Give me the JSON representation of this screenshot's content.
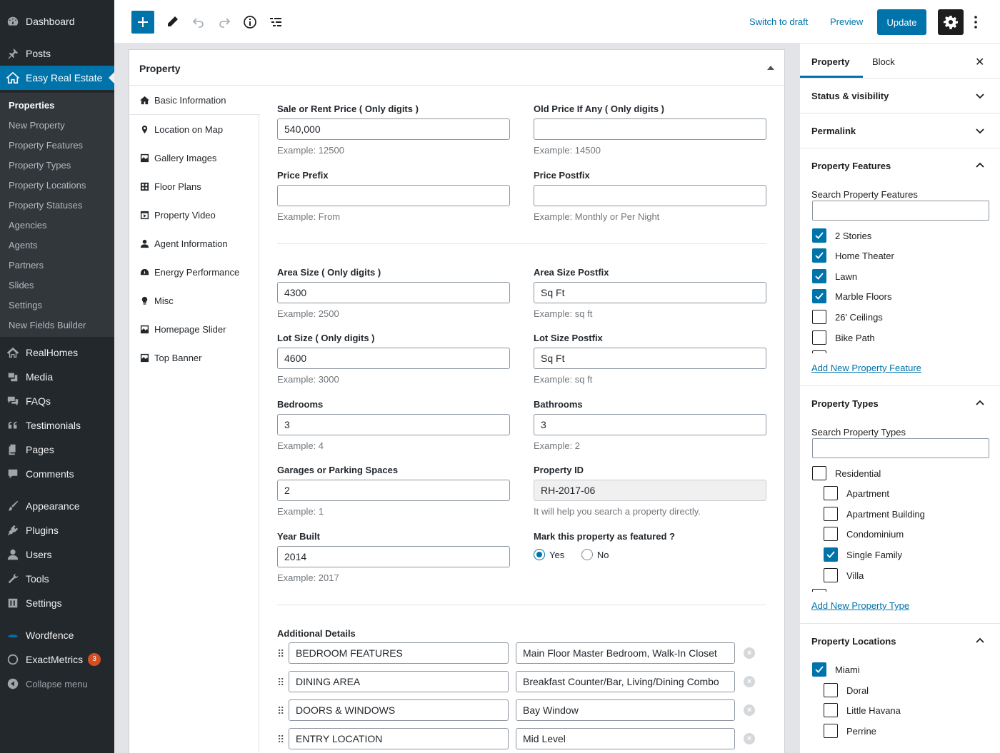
{
  "admin_menu": {
    "top_items": [
      {
        "label": "Dashboard",
        "icon": "dashboard-icon"
      },
      {
        "label": "Posts",
        "icon": "pin-icon"
      },
      {
        "label": "Easy Real Estate",
        "icon": "house-icon"
      },
      {
        "label": "RealHomes",
        "icon": "house-outline-icon"
      },
      {
        "label": "Media",
        "icon": "media-icon"
      },
      {
        "label": "FAQs",
        "icon": "chat-icon"
      },
      {
        "label": "Testimonials",
        "icon": "quote-icon"
      },
      {
        "label": "Pages",
        "icon": "pages-icon"
      },
      {
        "label": "Comments",
        "icon": "comment-icon"
      },
      {
        "label": "Appearance",
        "icon": "brush-icon"
      },
      {
        "label": "Plugins",
        "icon": "plug-icon"
      },
      {
        "label": "Users",
        "icon": "user-icon"
      },
      {
        "label": "Tools",
        "icon": "wrench-icon"
      },
      {
        "label": "Settings",
        "icon": "sliders-icon"
      },
      {
        "label": "Wordfence",
        "icon": "wordfence-icon"
      },
      {
        "label": "ExactMetrics",
        "icon": "metrics-icon",
        "badge": "3"
      }
    ],
    "submenu": [
      "Properties",
      "New Property",
      "Property Features",
      "Property Types",
      "Property Locations",
      "Property Statuses",
      "Agencies",
      "Agents",
      "Partners",
      "Slides",
      "Settings",
      "New Fields Builder"
    ],
    "collapse_label": "Collapse menu"
  },
  "toolbar": {
    "switch_draft": "Switch to draft",
    "preview": "Preview",
    "update": "Update"
  },
  "metabox": {
    "title": "Property",
    "tabs": [
      {
        "label": "Basic Information",
        "icon": "home-icon"
      },
      {
        "label": "Location on Map",
        "icon": "map-pin-icon"
      },
      {
        "label": "Gallery Images",
        "icon": "gallery-icon"
      },
      {
        "label": "Floor Plans",
        "icon": "floor-plan-icon"
      },
      {
        "label": "Property Video",
        "icon": "video-icon"
      },
      {
        "label": "Agent Information",
        "icon": "agent-icon"
      },
      {
        "label": "Energy Performance",
        "icon": "gauge-icon"
      },
      {
        "label": "Misc",
        "icon": "bulb-icon"
      },
      {
        "label": "Homepage Slider",
        "icon": "slider-icon"
      },
      {
        "label": "Top Banner",
        "icon": "banner-icon"
      }
    ],
    "fields": {
      "price": {
        "label": "Sale or Rent Price ( Only digits )",
        "value": "540,000",
        "example": "Example: 12500"
      },
      "old_price": {
        "label": "Old Price If Any ( Only digits )",
        "value": "",
        "example": "Example: 14500"
      },
      "price_prefix": {
        "label": "Price Prefix",
        "value": "",
        "example": "Example: From"
      },
      "price_postfix": {
        "label": "Price Postfix",
        "value": "",
        "example": "Example: Monthly or Per Night"
      },
      "area_size": {
        "label": "Area Size ( Only digits )",
        "value": "4300",
        "example": "Example: 2500"
      },
      "area_postfix": {
        "label": "Area Size Postfix",
        "value": "Sq Ft",
        "example": "Example: sq ft"
      },
      "lot_size": {
        "label": "Lot Size ( Only digits )",
        "value": "4600",
        "example": "Example: 3000"
      },
      "lot_postfix": {
        "label": "Lot Size Postfix",
        "value": "Sq Ft",
        "example": "Example: sq ft"
      },
      "bedrooms": {
        "label": "Bedrooms",
        "value": "3",
        "example": "Example: 4"
      },
      "bathrooms": {
        "label": "Bathrooms",
        "value": "3",
        "example": "Example: 2"
      },
      "garages": {
        "label": "Garages or Parking Spaces",
        "value": "2",
        "example": "Example: 1"
      },
      "property_id": {
        "label": "Property ID",
        "value": "RH-2017-06",
        "example": "It will help you search a property directly."
      },
      "year_built": {
        "label": "Year Built",
        "value": "2014",
        "example": "Example: 2017"
      },
      "featured": {
        "label": "Mark this property as featured ?",
        "yes": "Yes",
        "no": "No",
        "selected": "Yes"
      }
    },
    "additional": {
      "label": "Additional Details",
      "rows": [
        {
          "key": "BEDROOM FEATURES",
          "value": "Main Floor Master Bedroom, Walk-In Closet"
        },
        {
          "key": "DINING AREA",
          "value": "Breakfast Counter/Bar, Living/Dining Combo"
        },
        {
          "key": "DOORS & WINDOWS",
          "value": "Bay Window"
        },
        {
          "key": "ENTRY LOCATION",
          "value": "Mid Level"
        }
      ]
    }
  },
  "sidebar": {
    "tabs": [
      "Property",
      "Block"
    ],
    "panels": {
      "status": "Status & visibility",
      "permalink": "Permalink",
      "features": {
        "title": "Property Features",
        "search_label": "Search Property Features",
        "items": [
          {
            "label": "2 Stories",
            "checked": true
          },
          {
            "label": "Home Theater",
            "checked": true
          },
          {
            "label": "Lawn",
            "checked": true
          },
          {
            "label": "Marble Floors",
            "checked": true
          },
          {
            "label": "26' Ceilings",
            "checked": false
          },
          {
            "label": "Bike Path",
            "checked": false
          }
        ],
        "add_link": "Add New Property Feature"
      },
      "types": {
        "title": "Property Types",
        "search_label": "Search Property Types",
        "items": [
          {
            "label": "Residential",
            "checked": false,
            "child": false
          },
          {
            "label": "Apartment",
            "checked": false,
            "child": true
          },
          {
            "label": "Apartment Building",
            "checked": false,
            "child": true
          },
          {
            "label": "Condominium",
            "checked": false,
            "child": true
          },
          {
            "label": "Single Family",
            "checked": true,
            "child": true
          },
          {
            "label": "Villa",
            "checked": false,
            "child": true
          }
        ],
        "add_link": "Add New Property Type"
      },
      "locations": {
        "title": "Property Locations",
        "items": [
          {
            "label": "Miami",
            "checked": true,
            "child": false
          },
          {
            "label": "Doral",
            "checked": false,
            "child": true
          },
          {
            "label": "Little Havana",
            "checked": false,
            "child": true
          },
          {
            "label": "Perrine",
            "checked": false,
            "child": true
          }
        ]
      }
    }
  }
}
